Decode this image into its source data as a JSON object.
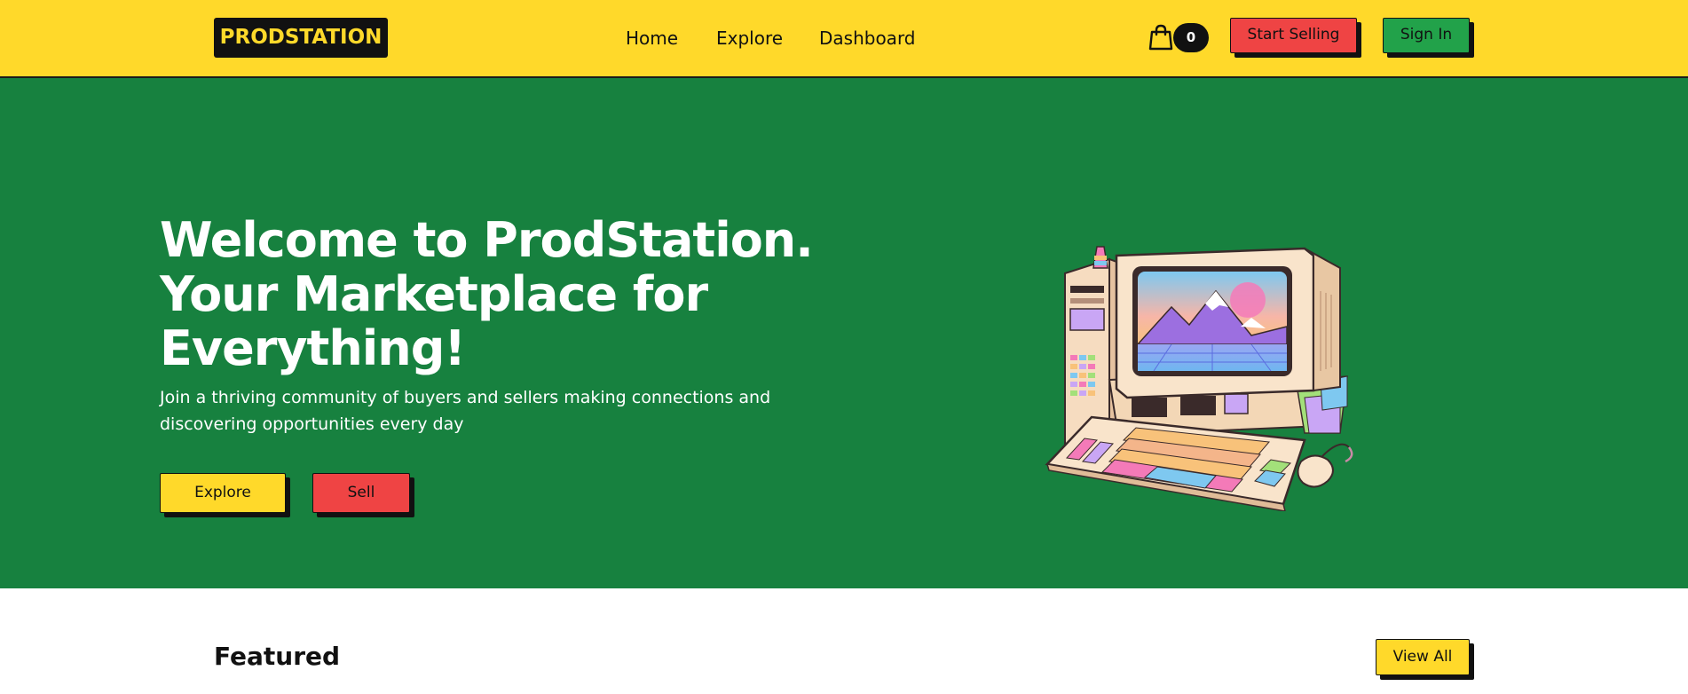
{
  "header": {
    "logo": "PRODSTATION",
    "nav": [
      {
        "label": "Home"
      },
      {
        "label": "Explore"
      },
      {
        "label": "Dashboard"
      }
    ],
    "cart_count": "0",
    "start_selling_label": "Start Selling",
    "sign_in_label": "Sign In"
  },
  "hero": {
    "title_lines": [
      "Welcome to ProdStation.",
      "Your Marketplace for",
      "Everything!"
    ],
    "subtitle": "Join a thriving community of buyers and sellers making connections and discovering opportunities every day",
    "explore_label": "Explore",
    "sell_label": "Sell",
    "illustration": "retro-computer-illustration"
  },
  "featured": {
    "title": "Featured",
    "view_all_label": "View All"
  },
  "colors": {
    "header_bg": "#FFD92A",
    "hero_bg": "#17813F",
    "accent_red": "#EF4444",
    "accent_green": "#22A24A",
    "dark": "#111111"
  },
  "icons": {
    "cart": "shopping-bag-icon"
  }
}
